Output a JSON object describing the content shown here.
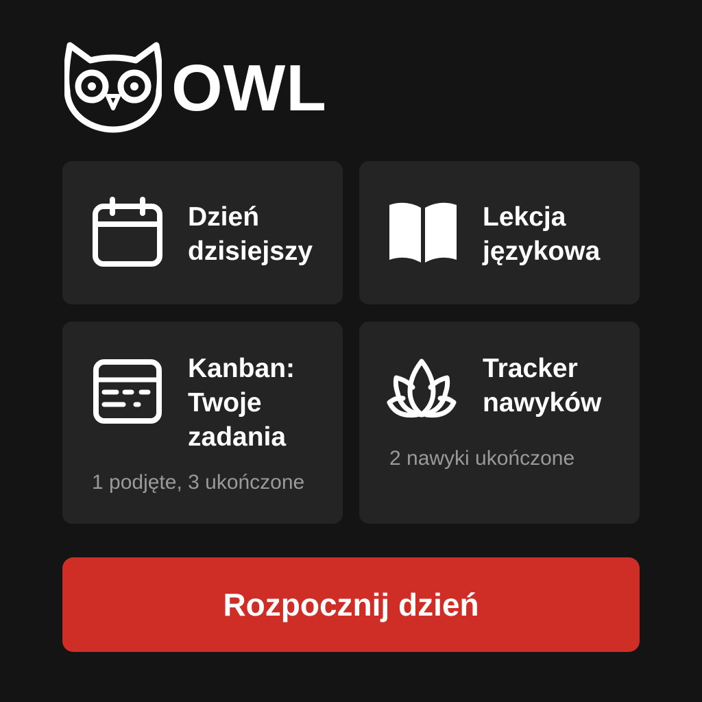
{
  "app": {
    "logo_text": "OWL",
    "logo_icon": "owl-icon"
  },
  "cards": [
    {
      "title": "Dzień\ndzisiejszy",
      "subtitle": "",
      "icon": "calendar-icon"
    },
    {
      "title": "Lekcja\njęzykowa",
      "subtitle": "",
      "icon": "open-book-icon"
    },
    {
      "title": "Kanban:\nTwoje\nzadania",
      "subtitle": "1 podjęte, 3 ukończone",
      "icon": "kanban-board-icon"
    },
    {
      "title": "Tracker\nnawyków",
      "subtitle": "2 nawyki ukończone",
      "icon": "lotus-icon"
    }
  ],
  "cta": {
    "label": "Rozpocznij dzień"
  },
  "colors": {
    "background": "#141414",
    "card": "#242424",
    "accent": "#ce2e26",
    "text": "#ffffff",
    "muted_text": "#9a9a9a"
  }
}
